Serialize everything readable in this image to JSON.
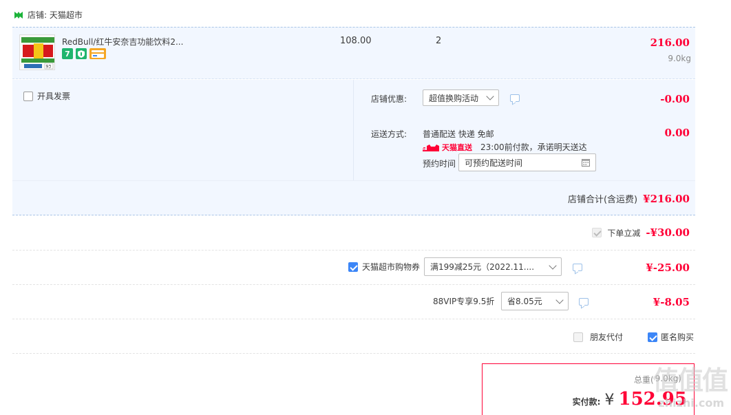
{
  "shop": {
    "label": "店铺: 天猫超市",
    "brand_color": "#1cb33a"
  },
  "item": {
    "title": "RedBull/红牛安奈吉功能饮料2...",
    "unit_price": "108.00",
    "quantity": "2",
    "subtotal": "216.00",
    "weight": "9.0kg",
    "badges": [
      {
        "icon": "seven-day-return-icon",
        "text": "7",
        "color": "#1fb56e"
      },
      {
        "icon": "service-guarantee-icon",
        "text": "",
        "color": "#1fb56e"
      },
      {
        "icon": "credit-card-icon",
        "text": "",
        "color": "#f5a623"
      }
    ],
    "thumb_number": "93"
  },
  "invoice": {
    "label": "开具发票"
  },
  "shop_discount": {
    "label": "店铺优惠:",
    "selected": "超值换购活动",
    "value": "-0.00"
  },
  "shipping": {
    "label": "运送方式:",
    "method": "普通配送 快递 免邮",
    "value": "0.00",
    "tmall_direct": "天猫直送",
    "promise": "23:00前付款，承诺明天送达",
    "reserve_label": "预约时间",
    "reserve_placeholder": "可预约配送时间"
  },
  "shop_total": {
    "label": "店铺合计(含运费)",
    "value": "¥216.00"
  },
  "instant_discount": {
    "label": "下单立减",
    "value": "-¥30.00"
  },
  "coupon": {
    "label": "天猫超市购物券",
    "selected": "满199减25元（2022.11....",
    "value": "¥-25.00"
  },
  "vip": {
    "label": "88VIP专享9.5折",
    "selected": "省8.05元",
    "value": "¥-8.05"
  },
  "friend_pay": {
    "label": "朋友代付"
  },
  "anonymous": {
    "label": "匿名购买"
  },
  "payment": {
    "weight_label": "总重(",
    "weight_value": "9.0kg)",
    "label": "实付款:",
    "currency": "¥",
    "value": "152.95"
  },
  "watermark": {
    "main": "值值值",
    "sub": "zhizhi.com"
  },
  "colors": {
    "accent_red": "#ff0036",
    "accent_blue": "#3c86f7",
    "panel_bg": "#f2f7ff"
  }
}
